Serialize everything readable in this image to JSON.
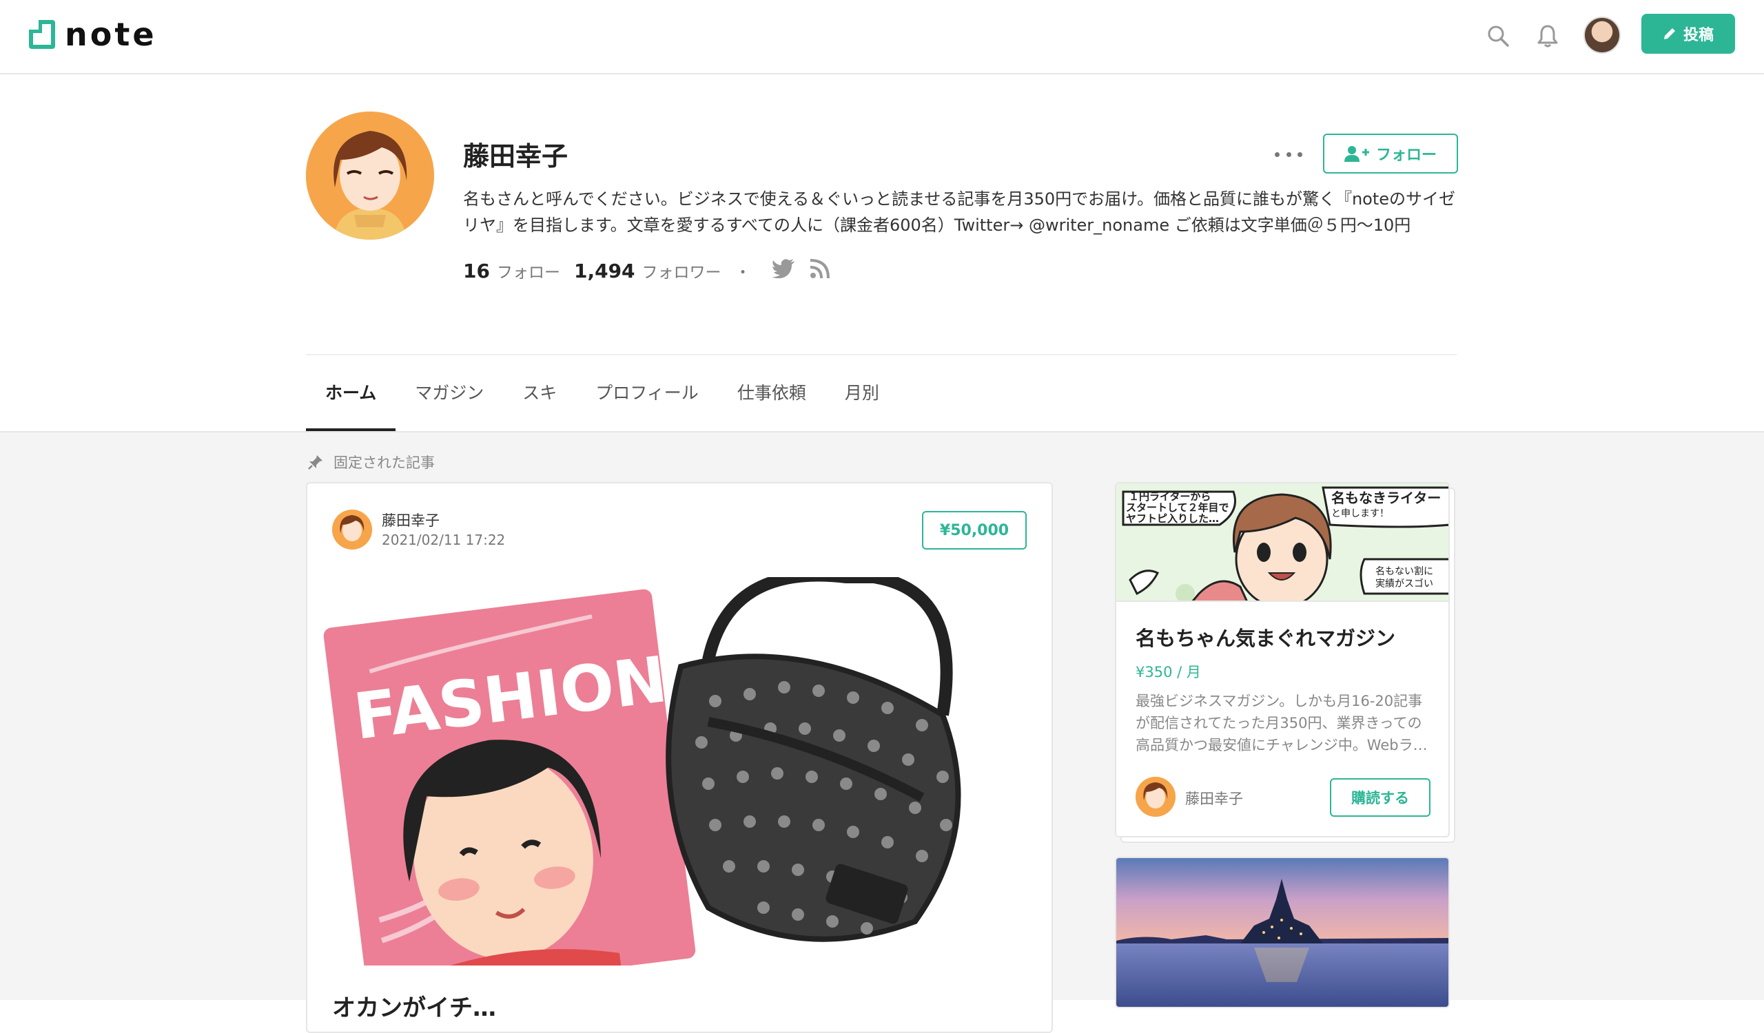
{
  "header": {
    "logo_text": "note",
    "post_label": "投稿",
    "icons": [
      "search-icon",
      "bell-icon",
      "avatar",
      "pencil-icon"
    ]
  },
  "profile": {
    "name": "藤田幸子",
    "follow_label": "フォロー",
    "bio": "名もさんと呼んでください。ビジネスで使える＆ぐいっと読ませる記事を月350円でお届け。価格と品質に誰もが驚く『noteのサイゼリヤ』を目指します。文章を愛するすべての人に（課金者600名）Twitter→ @writer_noname ご依頼は文字単価＠５円〜10円",
    "following_count": "16",
    "following_label": "フォロー",
    "followers_count": "1,494",
    "followers_label": "フォロワー",
    "separator": "・"
  },
  "tabs": [
    {
      "label": "ホーム",
      "active": true
    },
    {
      "label": "マガジン"
    },
    {
      "label": "スキ"
    },
    {
      "label": "プロフィール"
    },
    {
      "label": "仕事依頼"
    },
    {
      "label": "月別"
    }
  ],
  "pinned": {
    "label": "固定された記事",
    "author": "藤田幸子",
    "date": "2021/02/11 17:22",
    "price": "¥50,000",
    "image_text": "FASHION",
    "title": "オカンがイチ…"
  },
  "magazine": {
    "cover_bubble_1": "１円ライターから\nスタートして２年目で\nヤフトピ入りした…",
    "cover_bubble_2": "名もなきライター",
    "cover_bubble_2_sub": "と申します！",
    "cover_bubble_3": "名もない割に\n実績がスゴい",
    "title": "名もちゃん気まぐれマガジン",
    "price": "¥350 / 月",
    "description": "最強ビジネスマガジン。しかも月16-20記事が配信されてたった月350円、業界きっての高品質かつ最安値にチャレンジ中。Webラ…",
    "author": "藤田幸子",
    "subscribe_label": "購読する"
  },
  "colors": {
    "accent": "#2cb696",
    "background": "#f4f4f4"
  }
}
